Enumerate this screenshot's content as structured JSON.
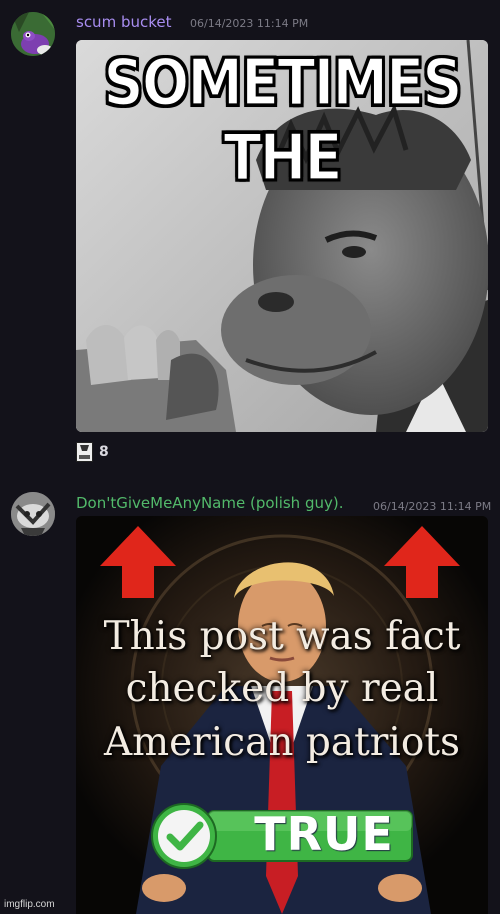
{
  "messages": [
    {
      "username": "scum bucket",
      "timestamp": "06/14/2023 11:14 PM",
      "username_color": "#a88df0",
      "image": {
        "top_text": "SOMETIMES THE",
        "subject": "grinch-in-suit-meme"
      },
      "reaction": {
        "emoji": "true-card-emoji",
        "emoji_text": "TRUE",
        "count": "8"
      }
    },
    {
      "username": "Don'tGiveMeAnyName (polish guy).",
      "timestamp": "06/14/2023 11:14 PM",
      "username_color": "#52b96a",
      "image": {
        "lines": [
          "This post was fact",
          "checked by real",
          "American patriots"
        ],
        "badge_text": "TRUE",
        "subject": "fact-check-meme"
      }
    }
  ],
  "watermark": "imgflip.com",
  "colors": {
    "background": "#13121a",
    "timestamp": "#7c7b86",
    "arrow_red": "#e0261b",
    "badge_green": "#3fb545"
  }
}
